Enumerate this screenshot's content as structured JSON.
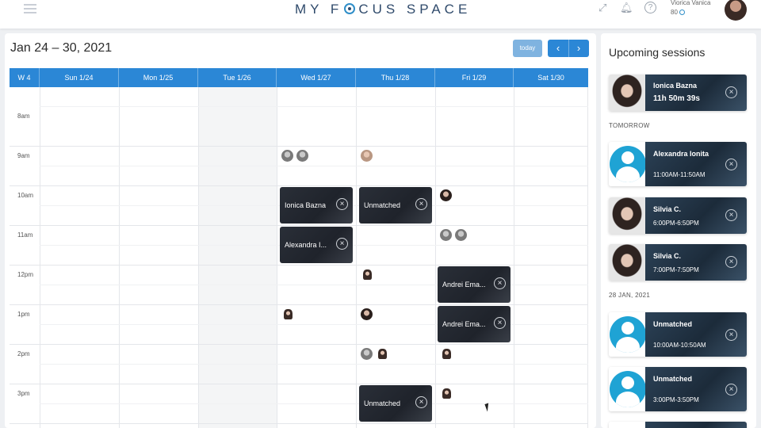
{
  "app": {
    "logo": "MY F",
    "logo_rest": "CUS SPACE",
    "user_name": "Viorica Vanica",
    "user_points": "80"
  },
  "toolbar": {
    "date_range": "Jan 24 – 30, 2021",
    "today_label": "today",
    "prev_icon": "chevron-left-icon",
    "next_icon": "chevron-right-icon"
  },
  "calendar": {
    "week_label": "W 4",
    "days": [
      "Sun 1/24",
      "Mon 1/25",
      "Tue 1/26",
      "Wed 1/27",
      "Thu 1/28",
      "Fri 1/29",
      "Sat 1/30"
    ],
    "hours": [
      "8am",
      "9am",
      "10am",
      "11am",
      "12pm",
      "1pm",
      "2pm",
      "3pm"
    ],
    "events": [
      {
        "label": "Ionica Bazna"
      },
      {
        "label": "Unmatched"
      },
      {
        "label": "Alexandra I..."
      },
      {
        "label": "Andrei Ema..."
      },
      {
        "label": "Andrei Ema..."
      },
      {
        "label": "Unmatched"
      }
    ]
  },
  "sidebar": {
    "title": "Upcoming sessions",
    "sections": [
      "TOMORROW",
      "28 JAN, 2021"
    ],
    "sessions": [
      {
        "name": "Ionica Bazna",
        "time": "11h 50m 39s"
      },
      {
        "name": "Alexandra Ionita",
        "time": "11:00AM-11:50AM"
      },
      {
        "name": "Silvia C.",
        "time": "6:00PM-6:50PM"
      },
      {
        "name": "Silvia C.",
        "time": "7:00PM-7:50PM"
      },
      {
        "name": "Unmatched",
        "time": "10:00AM-10:50AM"
      },
      {
        "name": "Unmatched",
        "time": "3:00PM-3:50PM"
      }
    ]
  },
  "colors": {
    "accent": "#2b87d6",
    "brand": "#2f4a6b",
    "avatar_default": "#1fa3d4",
    "event_bg": "#1f232b"
  }
}
